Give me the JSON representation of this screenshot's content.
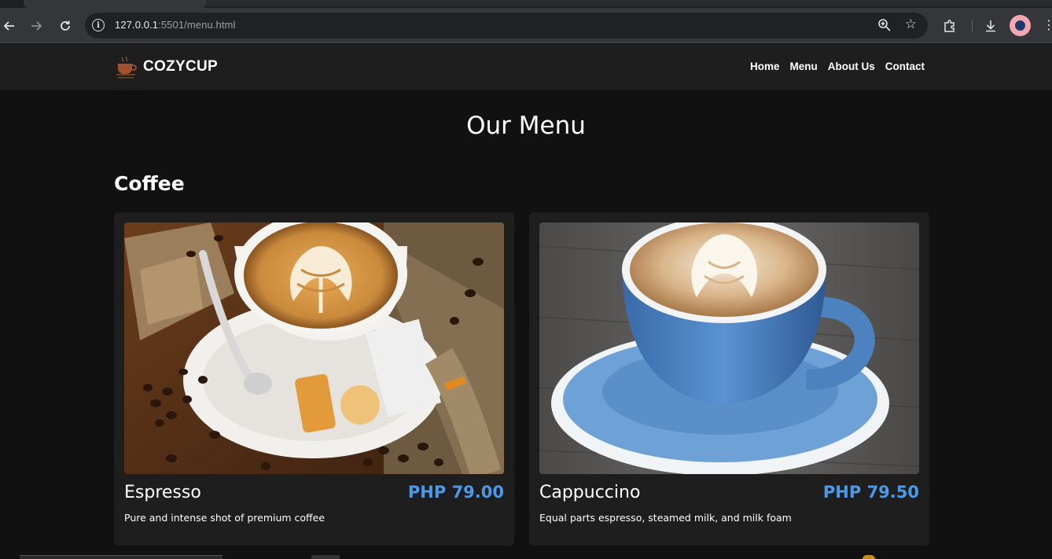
{
  "browser": {
    "url_host": "127.0.0.1",
    "url_rest": ":5501/menu.html",
    "icons": {
      "back": "back-arrow-icon",
      "forward": "forward-arrow-icon",
      "reload": "reload-icon",
      "site_info": "info-icon",
      "zoom": "zoom-icon",
      "bookmark": "star-icon",
      "extensions": "puzzle-icon",
      "downloads": "download-icon",
      "menu": "kebab-icon"
    }
  },
  "header": {
    "brand": "COZYCUP",
    "nav": [
      {
        "label": "Home"
      },
      {
        "label": "Menu"
      },
      {
        "label": "About Us"
      },
      {
        "label": "Contact"
      }
    ]
  },
  "page": {
    "title": "Our Menu",
    "sections": [
      {
        "title": "Coffee",
        "items": [
          {
            "name": "Espresso",
            "price": "PHP 79.00",
            "description": "Pure and intense shot of premium coffee"
          },
          {
            "name": "Cappuccino",
            "price": "PHP 79.50",
            "description": "Equal parts espresso, steamed milk, and milk foam"
          }
        ]
      }
    ]
  },
  "colors": {
    "background": "#111111",
    "header_bg": "#1e1e1e",
    "card_bg": "#1e1e1e",
    "price_accent": "#4a9ae8"
  }
}
